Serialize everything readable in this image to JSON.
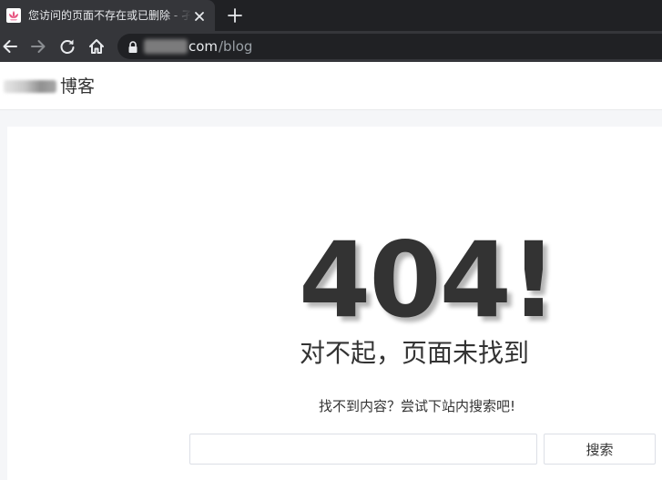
{
  "browser": {
    "tab": {
      "title": "您访问的页面不存在或已删除 - 孑",
      "favicon": "lotus-favicon-icon",
      "close_icon": "close-icon"
    },
    "new_tab_icon": "plus-icon",
    "toolbar": {
      "back_icon": "back-arrow-icon",
      "forward_icon": "forward-arrow-icon",
      "reload_icon": "reload-icon",
      "home_icon": "home-icon"
    },
    "address": {
      "lock_icon": "lock-icon",
      "host_visible": "com",
      "path": "/blog"
    },
    "colors": {
      "tabstrip": "#202124",
      "active_tab": "#35363a",
      "favicon_pink": "#e75480"
    }
  },
  "site": {
    "name": "博客"
  },
  "error": {
    "code": "404!",
    "title": "对不起，页面未找到",
    "hint": "找不到内容？尝试下站内搜索吧!",
    "search": {
      "placeholder": "",
      "value": "",
      "button_label": "搜索"
    }
  }
}
